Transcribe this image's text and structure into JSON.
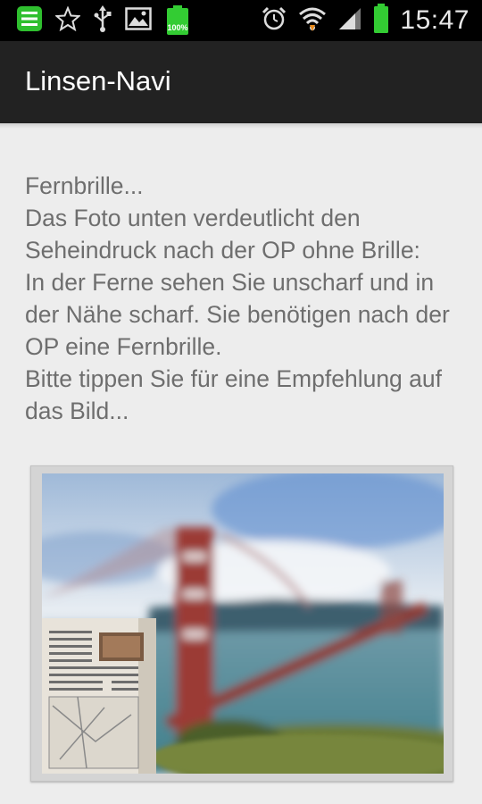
{
  "status_bar": {
    "time": "15:47",
    "battery_badge": "100%",
    "icons_left": [
      "list-icon",
      "star-icon",
      "usb-icon",
      "image-icon",
      "battery-full-icon"
    ],
    "icons_right": [
      "alarm-icon",
      "wifi-icon",
      "signal-icon",
      "battery-icon"
    ],
    "accent_color": "#33cc33"
  },
  "action_bar": {
    "title": "Linsen-Navi"
  },
  "content": {
    "lines": [
      "Fernbrille...",
      "Das Foto unten verdeutlicht den Seheindruck nach der OP ohne Brille:",
      "In der Ferne sehen Sie unscharf und in der Nähe scharf. Sie benötigen nach der OP eine Fernbrille.",
      "Bitte tippen Sie für eine Empfehlung auf das Bild..."
    ]
  },
  "photo": {
    "icon": "photo-golden-gate-blurred"
  }
}
